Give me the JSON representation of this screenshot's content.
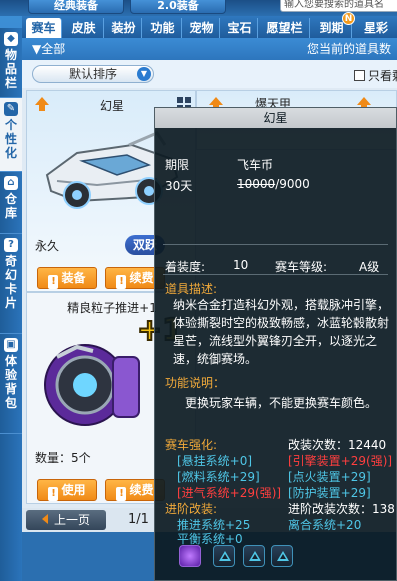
{
  "top": {
    "tabs": [
      "经典装备",
      "2.0装备"
    ],
    "search_placeholder": "输入您要搜索的道具名"
  },
  "left_nav": [
    {
      "label": "物品栏",
      "icon": "bag-icon"
    },
    {
      "label": "个性化",
      "icon": "brush-icon"
    },
    {
      "label": "仓库",
      "icon": "house-icon"
    },
    {
      "label": "奇幻卡片",
      "icon": "card-icon"
    },
    {
      "label": "体验背包",
      "icon": "gift-icon"
    }
  ],
  "category_tabs": [
    {
      "label": "赛车",
      "active": true
    },
    {
      "label": "皮肤"
    },
    {
      "label": "装扮"
    },
    {
      "label": "功能"
    },
    {
      "label": "宠物"
    },
    {
      "label": "宝石"
    },
    {
      "label": "愿望栏"
    },
    {
      "label": "到期",
      "badge": "N"
    },
    {
      "label": "星彩"
    }
  ],
  "subheader": {
    "filter_all": "全部",
    "notice": "您当前的道具数"
  },
  "sortbar": {
    "sort_label": "默认排序",
    "only_show": "只看剩"
  },
  "items": [
    {
      "name": "幻星",
      "duration": "永久",
      "tag": "",
      "equip_label": "装备",
      "renew_label": "续费"
    },
    {
      "name": "精良粒子推进+1",
      "plus": "+1",
      "count_label": "数量：5个",
      "use_label": "使用",
      "renew_label": "续费"
    },
    {
      "name": "爆天甲"
    }
  ],
  "pager": {
    "prev_label": "上一页",
    "page": "1/1"
  },
  "tooltip": {
    "title": "幻星",
    "period_label": "期限",
    "currency_label": "飞车币",
    "period_value": "30天",
    "old_price": "10000",
    "new_price": "/9000",
    "equip_label": "着装度:",
    "equip_value": "10",
    "level_label": "赛车等级:",
    "level_value": "A级",
    "desc_title": "道具描述:",
    "desc_text": "纳米合金打造科幻外观，搭载脉冲引擎，体验撕裂时空的极致畅感，冰蓝轮毂散射星芒，流线型外翼锋刃全开，以逐光之速，统御赛场。",
    "func_title": "功能说明：",
    "func_text": "更换玩家车辆，不能更换赛车颜色。",
    "enhance_title": "赛车强化:",
    "modify_count": "改装次数：12440",
    "enhance_left": [
      "[悬挂系统+0]",
      "[燃料系统+29]",
      "[进气系统+29(强)]"
    ],
    "enhance_right": [
      "[引擎装置+29(强)]",
      "[点火装置+29]",
      "[防护装置+29]"
    ],
    "advanced_title": "进阶改装:",
    "advanced_count": "进阶改装次数：138",
    "advanced_left": [
      "推进系统+25",
      "平衡系统+0"
    ],
    "advanced_right": [
      "离合系统+20"
    ],
    "skills": [
      "purple-skill-icon",
      "cyan-triangle-icon",
      "cyan-triangle-icon",
      "cyan-triangle-icon"
    ]
  }
}
